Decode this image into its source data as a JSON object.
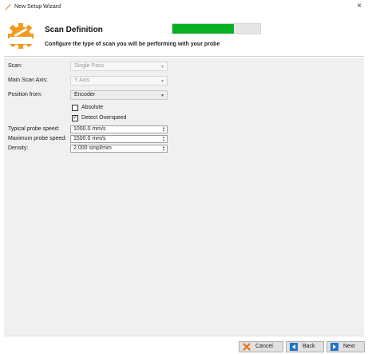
{
  "window": {
    "title": "New Setup Wizard",
    "close_glyph": "×"
  },
  "header": {
    "title": "Scan Definition",
    "subtitle": "Configure the type of scan you will be performing with your probe",
    "progress_fraction": 0.7,
    "icon": "gear-wrench-icon",
    "accent_color": "#f39a1c",
    "progress_color": "#06b025"
  },
  "form": {
    "scan": {
      "label": "Scan:",
      "value": "Single Pass",
      "enabled": false
    },
    "main_axis": {
      "label": "Main Scan Axis:",
      "value": "Y Axis",
      "enabled": false
    },
    "position_from": {
      "label": "Position from:",
      "value": "Encoder",
      "enabled": true
    },
    "absolute": {
      "label": "Absolute",
      "checked": false
    },
    "detect_overspeed": {
      "label": "Detect Overspeed",
      "checked": true
    },
    "typical_speed": {
      "label": "Typical probe speed:",
      "value": "1000.0 mm/s"
    },
    "max_speed": {
      "label": "Maximum probe speed:",
      "value": "1500.0 mm/s"
    },
    "density": {
      "label": "Density:",
      "value": "2.000 smpl/mm"
    }
  },
  "footer": {
    "cancel_label": "Cancel",
    "back_label": "Back",
    "next_label": "Next",
    "cancel_icon": "x-icon",
    "back_icon": "back-arrow-icon",
    "next_icon": "next-arrow-icon"
  }
}
